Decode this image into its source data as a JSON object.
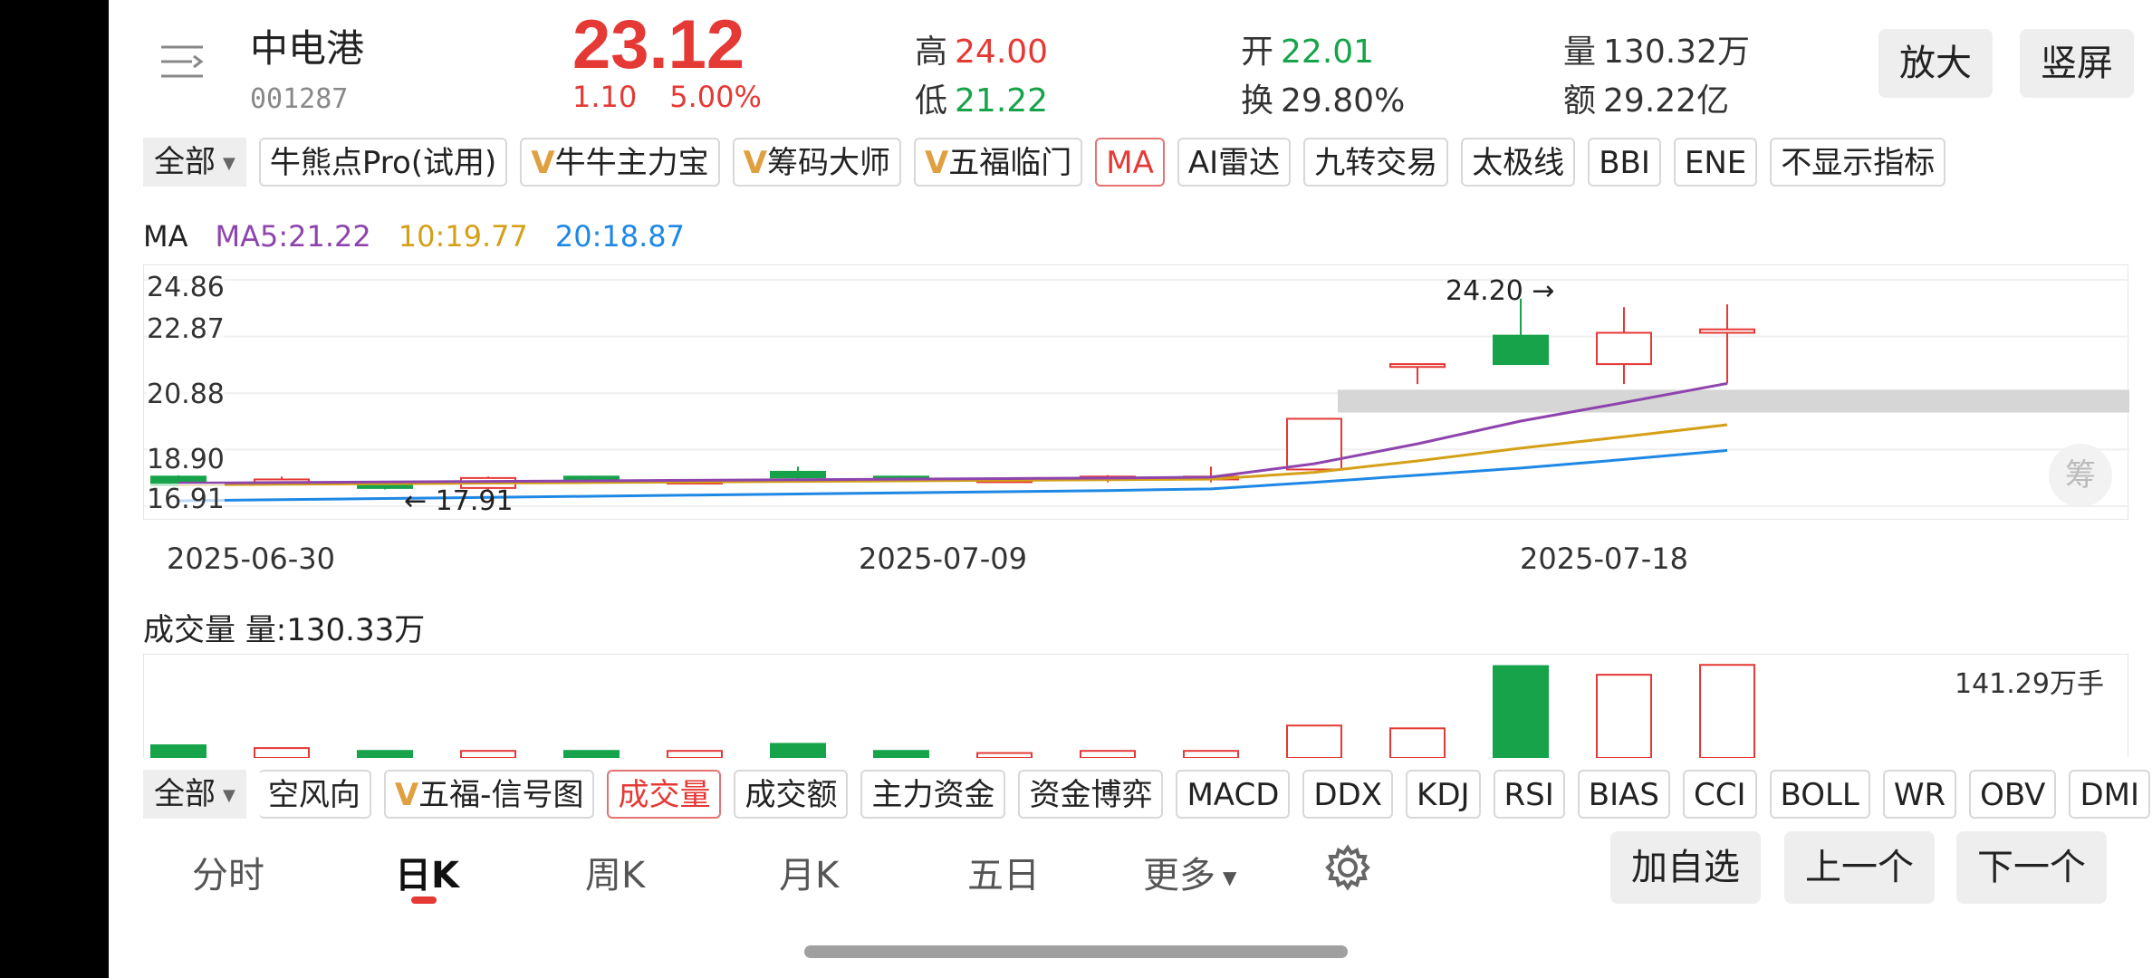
{
  "header": {
    "name": "中电港",
    "code": "001287",
    "price": "23.12",
    "change": "1.10",
    "change_pct": "5.00%",
    "high_label": "高",
    "high": "24.00",
    "low_label": "低",
    "low": "21.22",
    "open_label": "开",
    "open": "22.01",
    "turnover_label": "换",
    "turnover": "29.80%",
    "volume_label": "量",
    "volume": "130.32万",
    "amount_label": "额",
    "amount": "29.22亿",
    "zoom_btn": "放大",
    "portrait_btn": "竖屏"
  },
  "indicator_tabs": {
    "dropdown": "全部",
    "items": [
      {
        "label": "牛熊点Pro(试用)",
        "v": false,
        "selected": false
      },
      {
        "label": "牛牛主力宝",
        "v": true,
        "selected": false
      },
      {
        "label": "筹码大师",
        "v": true,
        "selected": false
      },
      {
        "label": "五福临门",
        "v": true,
        "selected": false
      },
      {
        "label": "MA",
        "v": false,
        "selected": true
      },
      {
        "label": "AI雷达",
        "v": false,
        "selected": false
      },
      {
        "label": "九转交易",
        "v": false,
        "selected": false
      },
      {
        "label": "太极线",
        "v": false,
        "selected": false
      },
      {
        "label": "BBI",
        "v": false,
        "selected": false
      },
      {
        "label": "ENE",
        "v": false,
        "selected": false
      },
      {
        "label": "不显示指标",
        "v": false,
        "selected": false
      }
    ],
    "v_mark": "V"
  },
  "ma_legend": {
    "title": "MA",
    "ma5": "MA5:21.22",
    "ma10": "10:19.77",
    "ma20": "20:18.87",
    "colors": {
      "ma5": "#8e44ad",
      "ma10": "#d4a017",
      "ma20": "#1e88e5"
    }
  },
  "chart_data": {
    "type": "candlestick",
    "y_ticks": [
      "24.86",
      "22.87",
      "20.88",
      "18.90",
      "16.91"
    ],
    "x_ticks": [
      "2025-06-30",
      "2025-07-09",
      "2025-07-18"
    ],
    "ylim": [
      16.91,
      24.86
    ],
    "max_marker": "24.20 →",
    "min_marker": "← 17.91",
    "candles": [
      {
        "o": 17.95,
        "c": 17.65,
        "h": 18.0,
        "l": 17.6
      },
      {
        "o": 17.85,
        "c": 17.85,
        "h": 17.95,
        "l": 17.75
      },
      {
        "o": 17.75,
        "c": 17.55,
        "h": 17.8,
        "l": 17.5
      },
      {
        "o": 17.55,
        "c": 17.9,
        "h": 17.95,
        "l": 17.5
      },
      {
        "o": 17.95,
        "c": 17.8,
        "h": 17.98,
        "l": 17.75
      },
      {
        "o": 17.8,
        "c": 17.8,
        "h": 17.85,
        "l": 17.75
      },
      {
        "o": 18.12,
        "c": 17.92,
        "h": 18.3,
        "l": 17.85
      },
      {
        "o": 17.95,
        "c": 17.85,
        "h": 17.98,
        "l": 17.8
      },
      {
        "o": 17.85,
        "c": 17.85,
        "h": 17.9,
        "l": 17.8
      },
      {
        "o": 17.85,
        "c": 17.95,
        "h": 18.0,
        "l": 17.75
      },
      {
        "o": 17.85,
        "c": 17.95,
        "h": 18.3,
        "l": 17.75
      },
      {
        "o": 18.2,
        "c": 19.98,
        "h": 19.98,
        "l": 18.2
      },
      {
        "o": 21.8,
        "c": 21.9,
        "h": 21.9,
        "l": 21.2
      },
      {
        "o": 22.9,
        "c": 21.9,
        "h": 24.2,
        "l": 21.9
      },
      {
        "o": 21.9,
        "c": 23.0,
        "h": 23.9,
        "l": 21.2
      },
      {
        "o": 23.0,
        "c": 23.12,
        "h": 24.0,
        "l": 21.22
      }
    ],
    "ma5": [
      17.72,
      17.74,
      17.76,
      17.78,
      17.8,
      17.82,
      17.84,
      17.86,
      17.88,
      17.9,
      17.93,
      18.4,
      19.1,
      19.9,
      20.55,
      21.22
    ],
    "ma10": [
      17.66,
      17.68,
      17.7,
      17.72,
      17.74,
      17.76,
      17.78,
      17.8,
      17.82,
      17.84,
      17.86,
      18.1,
      18.5,
      18.95,
      19.35,
      19.77
    ],
    "ma20": [
      17.1,
      17.14,
      17.18,
      17.22,
      17.26,
      17.3,
      17.34,
      17.38,
      17.42,
      17.46,
      17.52,
      17.75,
      18.0,
      18.25,
      18.55,
      18.87
    ],
    "volumes": [
      18,
      14,
      10,
      10,
      10,
      10,
      20,
      10,
      7,
      10,
      10,
      46,
      42,
      130.33,
      118,
      132
    ],
    "vol_ylim": [
      0,
      141.29
    ],
    "chou_label": "筹"
  },
  "volume": {
    "title": "成交量",
    "value": "量:130.33万",
    "max_label": "141.29万手"
  },
  "sub_tabs": {
    "dropdown": "全部",
    "items": [
      {
        "label": "空风向",
        "v": false,
        "selected": false
      },
      {
        "label": "五福-信号图",
        "v": true,
        "selected": false
      },
      {
        "label": "成交量",
        "v": false,
        "selected": true
      },
      {
        "label": "成交额",
        "v": false,
        "selected": false
      },
      {
        "label": "主力资金",
        "v": false,
        "selected": false
      },
      {
        "label": "资金博弈",
        "v": false,
        "selected": false
      },
      {
        "label": "MACD",
        "v": false,
        "selected": false
      },
      {
        "label": "DDX",
        "v": false,
        "selected": false
      },
      {
        "label": "KDJ",
        "v": false,
        "selected": false
      },
      {
        "label": "RSI",
        "v": false,
        "selected": false
      },
      {
        "label": "BIAS",
        "v": false,
        "selected": false
      },
      {
        "label": "CCI",
        "v": false,
        "selected": false
      },
      {
        "label": "BOLL",
        "v": false,
        "selected": false
      },
      {
        "label": "WR",
        "v": false,
        "selected": false
      },
      {
        "label": "OBV",
        "v": false,
        "selected": false
      },
      {
        "label": "DMI",
        "v": false,
        "selected": false
      }
    ]
  },
  "period_tabs": [
    "分时",
    "日K",
    "周K",
    "月K",
    "五日",
    "更多"
  ],
  "bottom_buttons": {
    "add": "加自选",
    "prev": "上一个",
    "next": "下一个"
  },
  "colors": {
    "up": "#e53935",
    "down": "#16a34a"
  }
}
